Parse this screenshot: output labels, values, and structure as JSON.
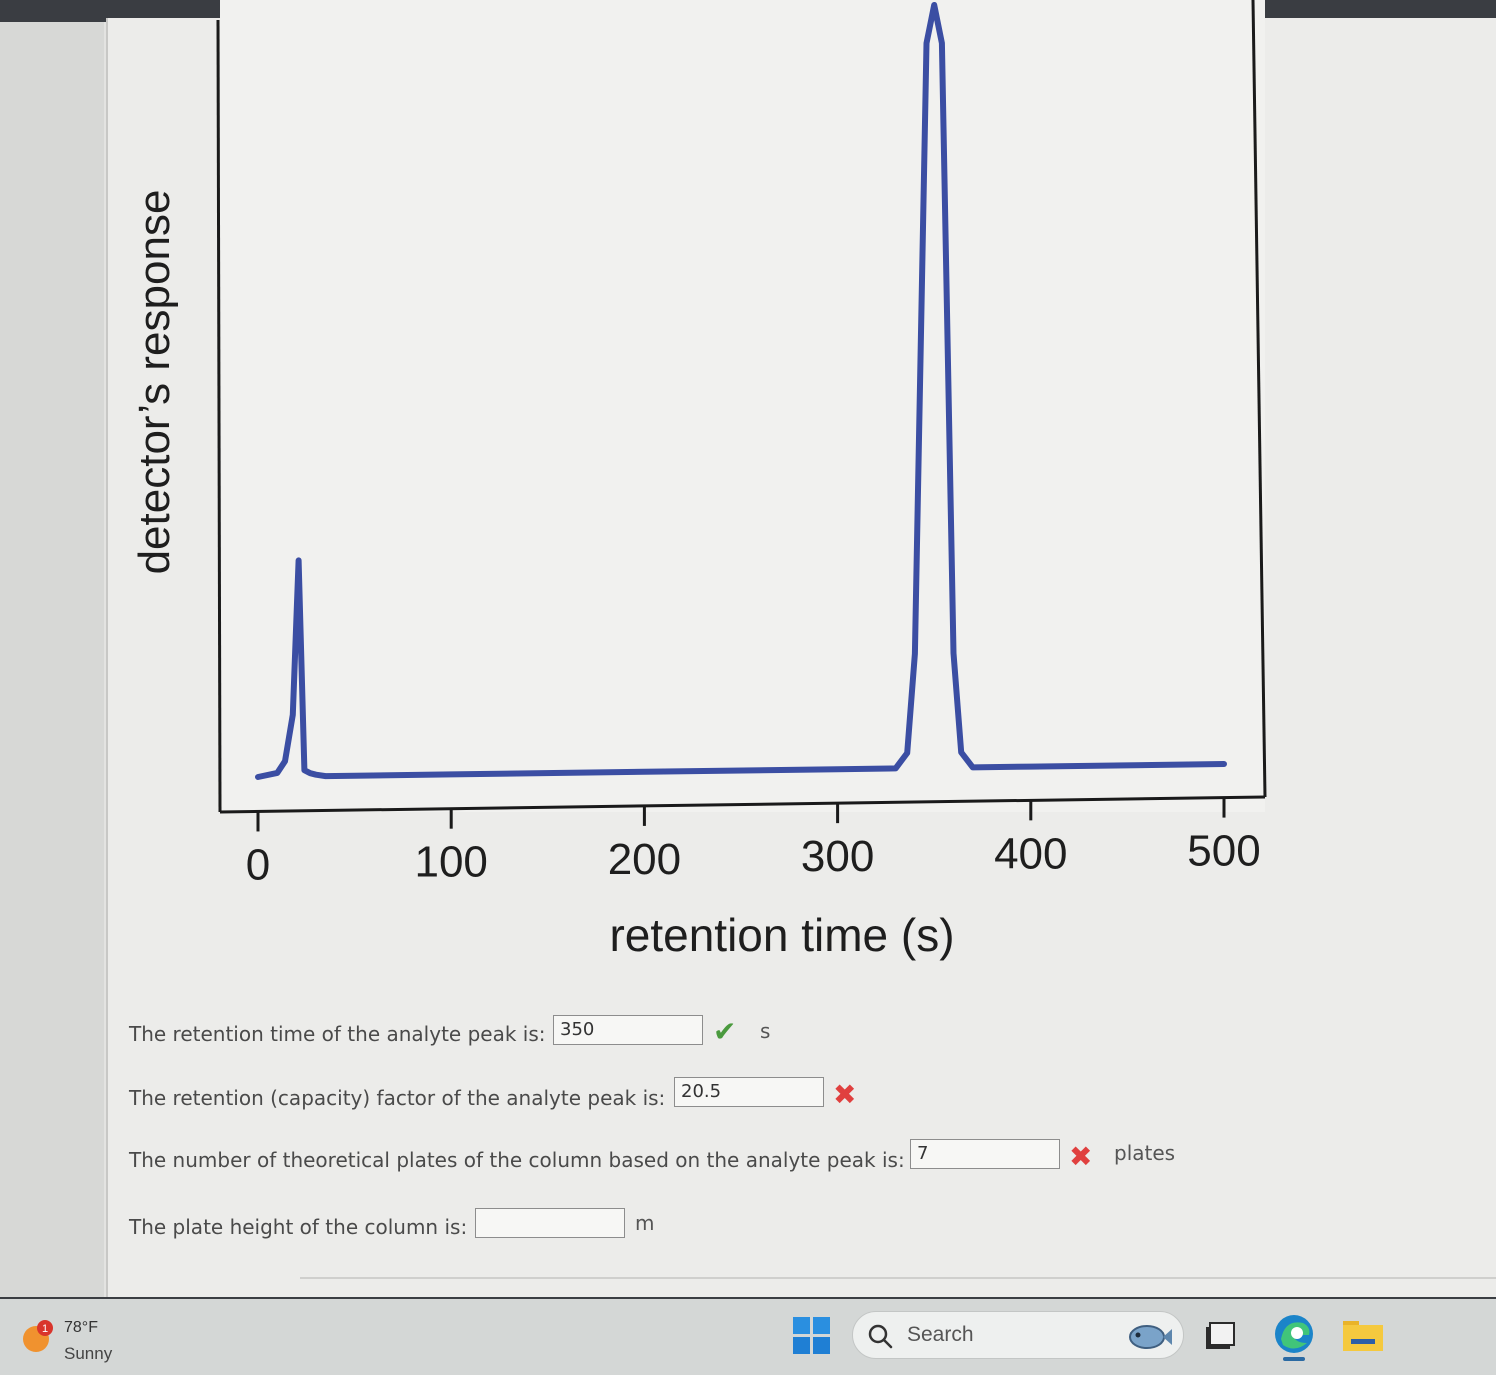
{
  "chart_data": {
    "type": "line",
    "xlabel": "retention time (s)",
    "ylabel": "detector’s response",
    "xlim": [
      0,
      500
    ],
    "x_ticks": [
      "0",
      "100",
      "200",
      "300",
      "400",
      "500"
    ],
    "grid": false,
    "series": [
      {
        "color": "#3b4ea3",
        "x": [
          0,
          10,
          14,
          18,
          21,
          24,
          27,
          30,
          35,
          50,
          100,
          200,
          300,
          330,
          336,
          340,
          343,
          346,
          350,
          354,
          357,
          360,
          364,
          370,
          400,
          500
        ],
        "y": [
          0,
          0.5,
          2,
          8,
          28,
          0.8,
          0.4,
          0.2,
          0,
          0,
          0,
          0,
          0,
          0,
          2,
          15,
          55,
          95,
          100,
          95,
          55,
          15,
          2,
          0,
          0,
          0
        ]
      }
    ]
  },
  "questions": [
    {
      "label": "The retention time of the analyte peak is:",
      "value": "350",
      "unit": "s",
      "status": "correct"
    },
    {
      "label": "The retention (capacity) factor of the analyte peak is:",
      "value": "20.5",
      "unit": "",
      "status": "incorrect"
    },
    {
      "label": "The number of theoretical plates of the column based on the analyte peak is:",
      "value": "7",
      "unit": "plates",
      "status": "incorrect"
    },
    {
      "label": "The plate height of the column is:",
      "value": "",
      "unit": "m",
      "status": "none"
    }
  ],
  "marks": {
    "check": "✔",
    "cross": "✖"
  },
  "taskbar": {
    "weather_badge": "1",
    "weather_temp": "78°F",
    "weather_condition": "Sunny",
    "search_label": "Search",
    "icons": [
      "weather-icon",
      "windows-start-icon",
      "search-icon",
      "fish-widget-icon",
      "task-view-icon",
      "edge-browser-icon",
      "file-explorer-icon"
    ]
  }
}
